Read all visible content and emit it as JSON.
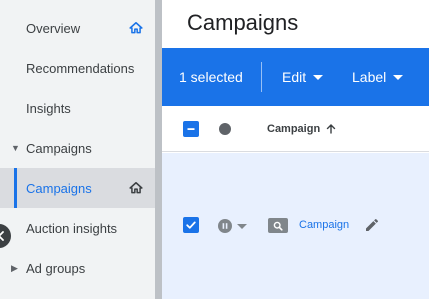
{
  "sidebar": {
    "items": [
      {
        "label": "Overview",
        "icon": "home-icon"
      },
      {
        "label": "Recommendations"
      },
      {
        "label": "Insights"
      },
      {
        "label": "Campaigns",
        "expanded": true
      },
      {
        "label": "Campaigns",
        "active": true,
        "icon": "home-outline-icon"
      },
      {
        "label": "Auction insights"
      },
      {
        "label": "Ad groups",
        "expanded": false
      }
    ]
  },
  "main": {
    "title": "Campaigns",
    "action_bar": {
      "selected_text": "1 selected",
      "edit_label": "Edit",
      "label_label": "Label"
    },
    "table": {
      "header": {
        "column_campaign": "Campaign",
        "sort": "ascending"
      },
      "rows": [
        {
          "selected": true,
          "status": "paused",
          "type_icon": "search-campaign-icon",
          "name": "Campaign"
        }
      ]
    }
  },
  "colors": {
    "accent": "#1a73e8",
    "sidebar_bg": "#f1f3f4",
    "active_item_bg": "#dadce0",
    "selected_row_bg": "#e8f0fe"
  }
}
